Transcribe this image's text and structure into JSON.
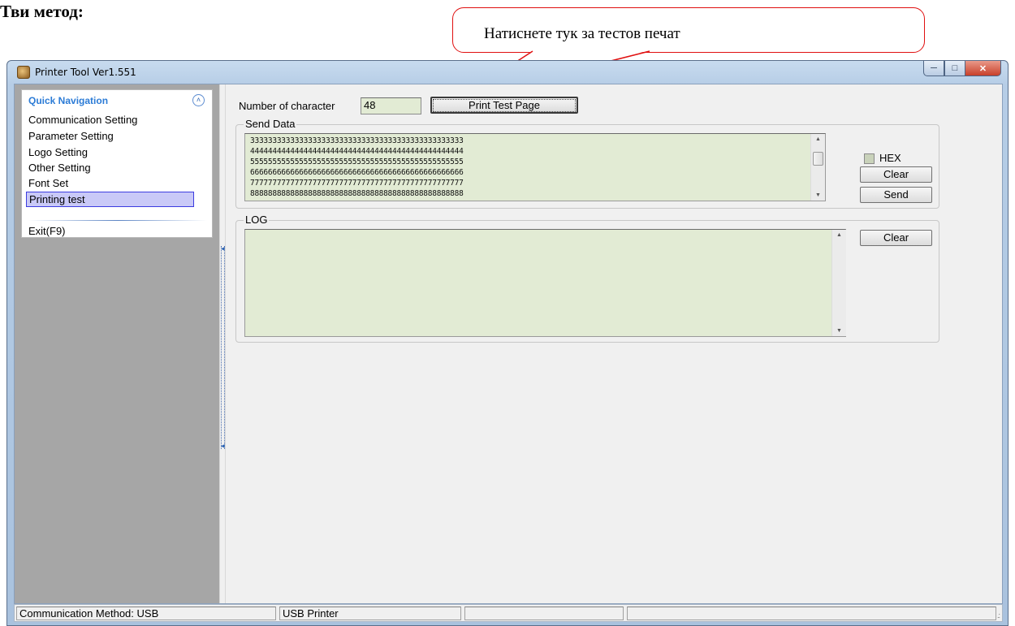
{
  "document": {
    "heading": "Тви метод:",
    "callout_text": "Натиснете тук за тестов печат"
  },
  "window": {
    "title": "Printer Tool Ver1.551",
    "caption_buttons": [
      "minimize",
      "maximize",
      "close"
    ]
  },
  "navigation": {
    "header": "Quick Navigation",
    "items": [
      {
        "label": "Communication Setting",
        "active": false
      },
      {
        "label": "Parameter Setting",
        "active": false
      },
      {
        "label": "Logo Setting",
        "active": false
      },
      {
        "label": "Other Setting",
        "active": false
      },
      {
        "label": "Font Set",
        "active": false
      },
      {
        "label": "Printing test",
        "active": true
      }
    ],
    "exit_label": "Exit(F9)"
  },
  "main": {
    "number_of_character_label": "Number of character",
    "number_of_character_value": "48",
    "print_test_page_label": "Print Test Page",
    "send_data": {
      "title": "Send Data",
      "lines": [
        "333333333333333333333333333333333333333333333333",
        "444444444444444444444444444444444444444444444444",
        "555555555555555555555555555555555555555555555555",
        "666666666666666666666666666666666666666666666666",
        "777777777777777777777777777777777777777777777777",
        "888888888888888888888888888888888888888888888888"
      ],
      "hex_label": "HEX",
      "hex_checked": false,
      "clear_label": "Clear",
      "send_label": "Send"
    },
    "log": {
      "title": "LOG",
      "content": "",
      "clear_label": "Clear"
    }
  },
  "status_bar": {
    "communication": "Communication Method: USB",
    "device": "USB Printer",
    "panel3": "",
    "panel4": ""
  },
  "colors": {
    "callout_border": "#e01010",
    "input_background": "#e2ebd4",
    "nav_header": "#2b7bd6",
    "nav_active_border": "#3c3ce0",
    "left_panel": "#a6a6a6"
  }
}
